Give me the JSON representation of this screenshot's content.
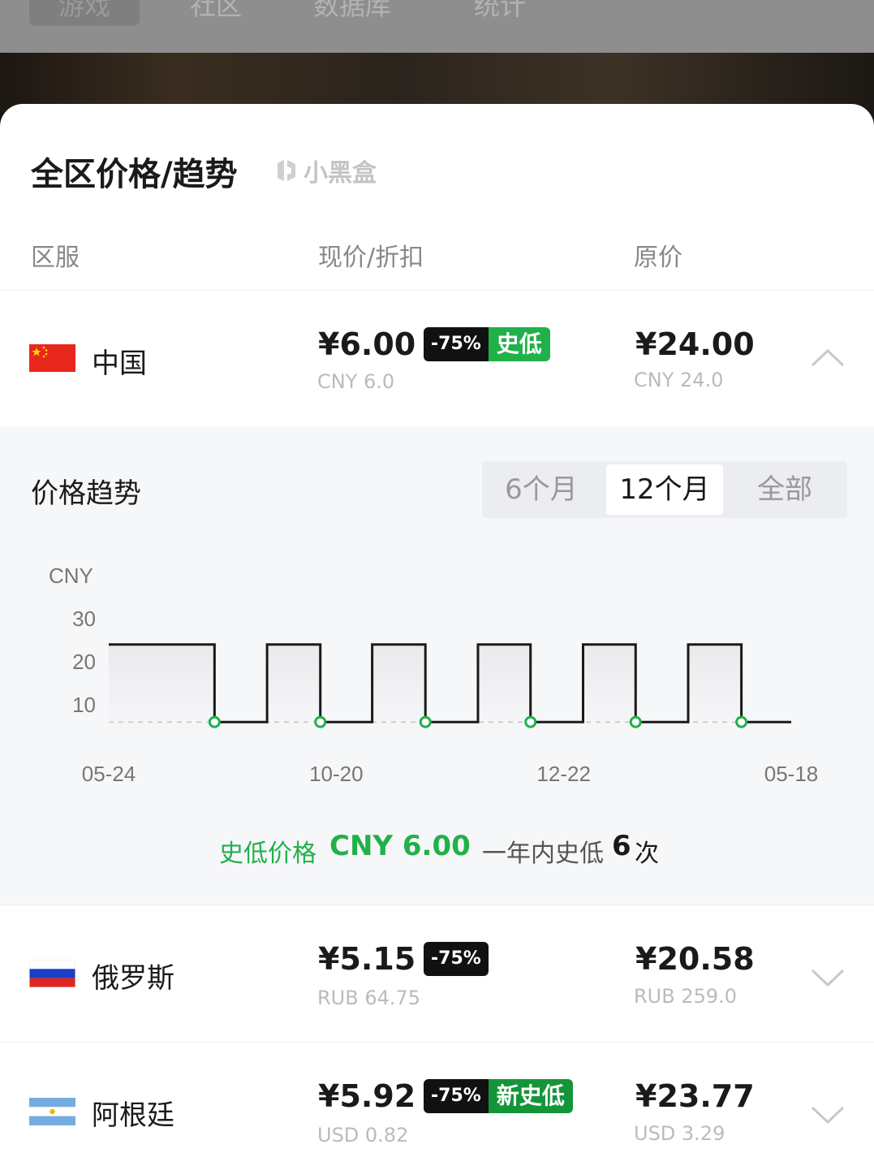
{
  "top_tabs": [
    "游戏",
    "社区",
    "数据库",
    "统计"
  ],
  "sheet": {
    "title": "全区价格/趋势",
    "brand": "小黑盒",
    "headers": {
      "region": "区服",
      "price": "现价/折扣",
      "original": "原价"
    }
  },
  "regions": [
    {
      "name": "中国",
      "flag": "china-flag",
      "price": "¥6.00",
      "local_price": "CNY 6.0",
      "discount": "-75%",
      "tag": "史低",
      "original": "¥24.00",
      "local_original": "CNY 24.0",
      "expanded": true
    },
    {
      "name": "俄罗斯",
      "flag": "russia-flag",
      "price": "¥5.15",
      "local_price": "RUB 64.75",
      "discount": "-75%",
      "tag": "",
      "original": "¥20.58",
      "local_original": "RUB 259.0",
      "expanded": false
    },
    {
      "name": "阿根廷",
      "flag": "argentina-flag",
      "price": "¥5.92",
      "local_price": "USD 0.82",
      "discount": "-75%",
      "tag": "新史低",
      "original": "¥23.77",
      "local_original": "USD 3.29",
      "expanded": false
    }
  ],
  "trend": {
    "title": "价格趋势",
    "ranges": [
      "6个月",
      "12个月",
      "全部"
    ],
    "selected_range": "12个月",
    "low_price_label": "史低价格",
    "low_price_value": "CNY 6.00",
    "low_count_prefix": "一年内史低",
    "low_count": "6",
    "low_count_suffix": "次"
  },
  "colors": {
    "green": "#22b04a",
    "dark": "#111111"
  },
  "chart_data": {
    "type": "line",
    "step": true,
    "ylabel": "CNY",
    "yticks": [
      10,
      20,
      30
    ],
    "ylim": [
      0,
      34
    ],
    "xtick_labels": [
      "05-24",
      "10-20",
      "12-22",
      "05-18"
    ],
    "x_range": [
      0,
      1
    ],
    "series": [
      {
        "name": "",
        "points": [
          [
            0.0,
            24
          ],
          [
            0.155,
            24
          ],
          [
            0.155,
            6
          ],
          [
            0.232,
            6
          ],
          [
            0.232,
            24
          ],
          [
            0.31,
            24
          ],
          [
            0.31,
            6
          ],
          [
            0.386,
            6
          ],
          [
            0.386,
            24
          ],
          [
            0.464,
            24
          ],
          [
            0.464,
            6
          ],
          [
            0.541,
            6
          ],
          [
            0.541,
            24
          ],
          [
            0.618,
            24
          ],
          [
            0.618,
            6
          ],
          [
            0.695,
            6
          ],
          [
            0.695,
            24
          ],
          [
            0.772,
            24
          ],
          [
            0.772,
            6
          ],
          [
            0.849,
            6
          ],
          [
            0.849,
            24
          ],
          [
            0.927,
            24
          ],
          [
            0.927,
            6
          ],
          [
            1.0,
            6
          ]
        ]
      }
    ],
    "historic_low_points": [
      [
        0.155,
        6
      ],
      [
        0.31,
        6
      ],
      [
        0.464,
        6
      ],
      [
        0.618,
        6
      ],
      [
        0.772,
        6
      ],
      [
        0.927,
        6
      ]
    ],
    "historic_low_line": 6
  }
}
